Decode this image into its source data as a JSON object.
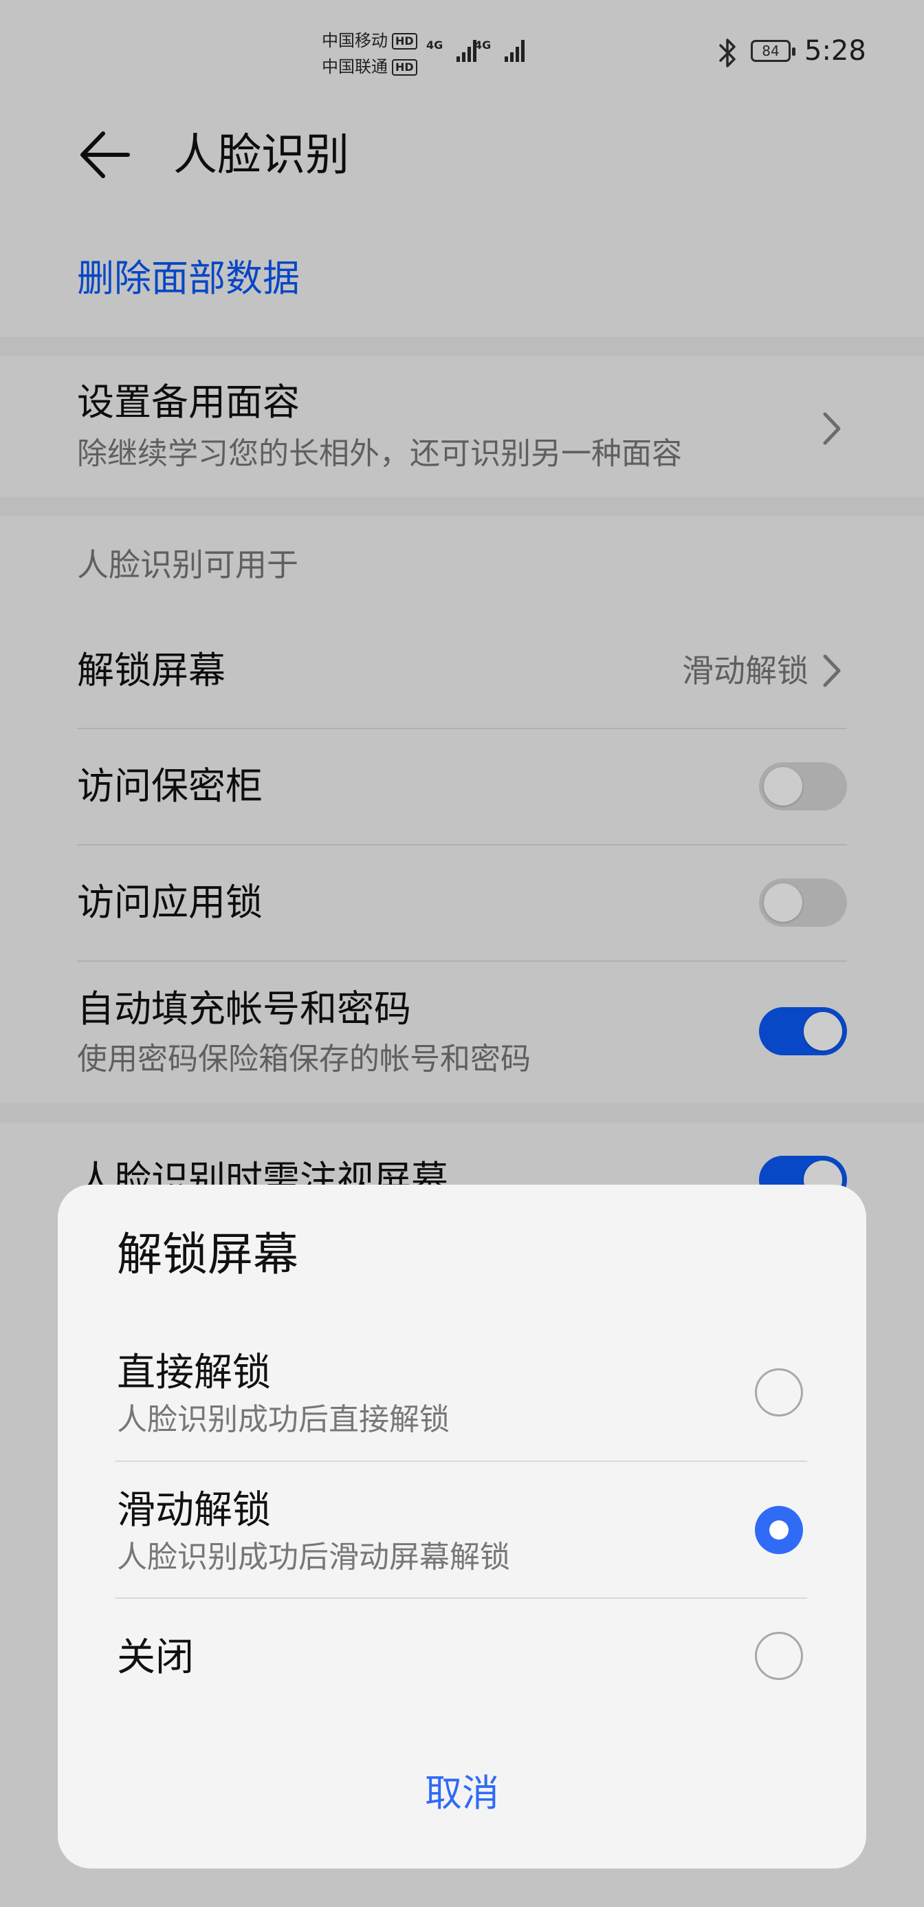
{
  "status_bar": {
    "carrier_1": "中国移动",
    "carrier_2": "中国联通",
    "hd_badge": "HD",
    "network_1": "4G",
    "network_2": "4G",
    "battery": "84",
    "time": "5:28"
  },
  "header": {
    "title": "人脸识别"
  },
  "delete_link": "删除面部数据",
  "backup_face": {
    "title": "设置备用面容",
    "subtitle": "除继续学习您的长相外，还可识别另一种面容"
  },
  "usage_section": {
    "label": "人脸识别可用于",
    "items": [
      {
        "title": "解锁屏幕",
        "value": "滑动解锁"
      },
      {
        "title": "访问保密柜",
        "on": false
      },
      {
        "title": "访问应用锁",
        "on": false
      },
      {
        "title": "自动填充帐号和密码",
        "subtitle": "使用密码保险箱保存的帐号和密码",
        "on": true
      }
    ]
  },
  "partial_row": {
    "title": "人脸识别时需注视屏幕",
    "on": true
  },
  "dialog": {
    "title": "解锁屏幕",
    "options": [
      {
        "title": "直接解锁",
        "subtitle": "人脸识别成功后直接解锁",
        "selected": false
      },
      {
        "title": "滑动解锁",
        "subtitle": "人脸识别成功后滑动屏幕解锁",
        "selected": true
      },
      {
        "title": "关闭",
        "selected": false
      }
    ],
    "cancel_label": "取消"
  },
  "colors": {
    "accent": "#0a59f7",
    "radio_selected": "#2f6bf5",
    "switch_off": "#d6d6d6"
  }
}
